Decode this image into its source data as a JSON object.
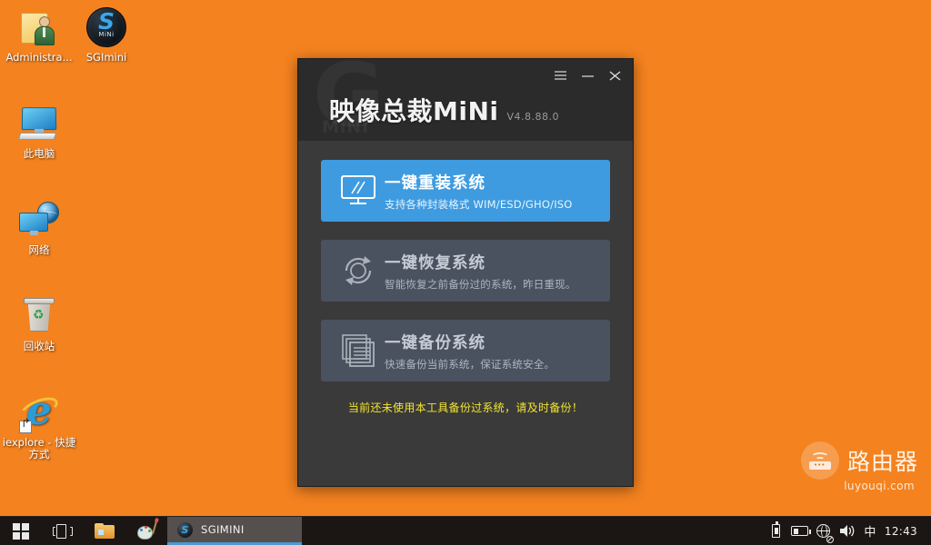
{
  "desktop": {
    "background_color": "#F4821F",
    "icons": [
      {
        "name": "administrator-folder",
        "label": "Administra...",
        "icon": "user-folder-icon"
      },
      {
        "name": "sgimini",
        "label": "SGImini",
        "icon": "sgimini-logo-icon"
      },
      {
        "name": "this-pc",
        "label": "此电脑",
        "icon": "computer-icon"
      },
      {
        "name": "network",
        "label": "网络",
        "icon": "network-globe-icon"
      },
      {
        "name": "recycle-bin",
        "label": "回收站",
        "icon": "recycle-bin-icon"
      },
      {
        "name": "iexplore-shortcut",
        "label": "iexplore - 快捷方式",
        "icon": "internet-explorer-icon"
      }
    ]
  },
  "app_window": {
    "title": "映像总裁MiNi",
    "version": "V4.8.88.0",
    "watermark_logo": "G",
    "watermark_sub": "MiNi",
    "controls": {
      "menu": "menu-hamburger",
      "minimize": "minimize",
      "close": "close"
    },
    "accent_color": "#3E9BE0",
    "actions": [
      {
        "id": "reinstall",
        "title": "一键重装系统",
        "subtitle": "支持各种封装格式 WIM/ESD/GHO/ISO",
        "icon": "monitor-icon",
        "style": "primary"
      },
      {
        "id": "restore",
        "title": "一键恢复系统",
        "subtitle": "智能恢复之前备份过的系统，昨日重现。",
        "icon": "restore-circular-arrows-icon",
        "style": "secondary"
      },
      {
        "id": "backup",
        "title": "一键备份系统",
        "subtitle": "快速备份当前系统，保证系统安全。",
        "icon": "stacked-documents-icon",
        "style": "secondary"
      }
    ],
    "status_note": "当前还未使用本工具备份过系统，请及时备份！",
    "status_color": "#F2E530"
  },
  "watermark": {
    "text": "路由器",
    "url": "luyouqi.com",
    "icon": "router-icon"
  },
  "taskbar": {
    "start": "start-windows-icon",
    "task_view": "task-view-icon",
    "file_explorer": "file-explorer-icon",
    "paint": "paint-palette-icon",
    "active_task": "SGIMINI",
    "tray": {
      "usb": "usb-eject-icon",
      "battery": "battery-icon",
      "network": "network-disconnected-icon",
      "volume": "volume-icon",
      "ime": "中",
      "clock": "12:43"
    }
  }
}
